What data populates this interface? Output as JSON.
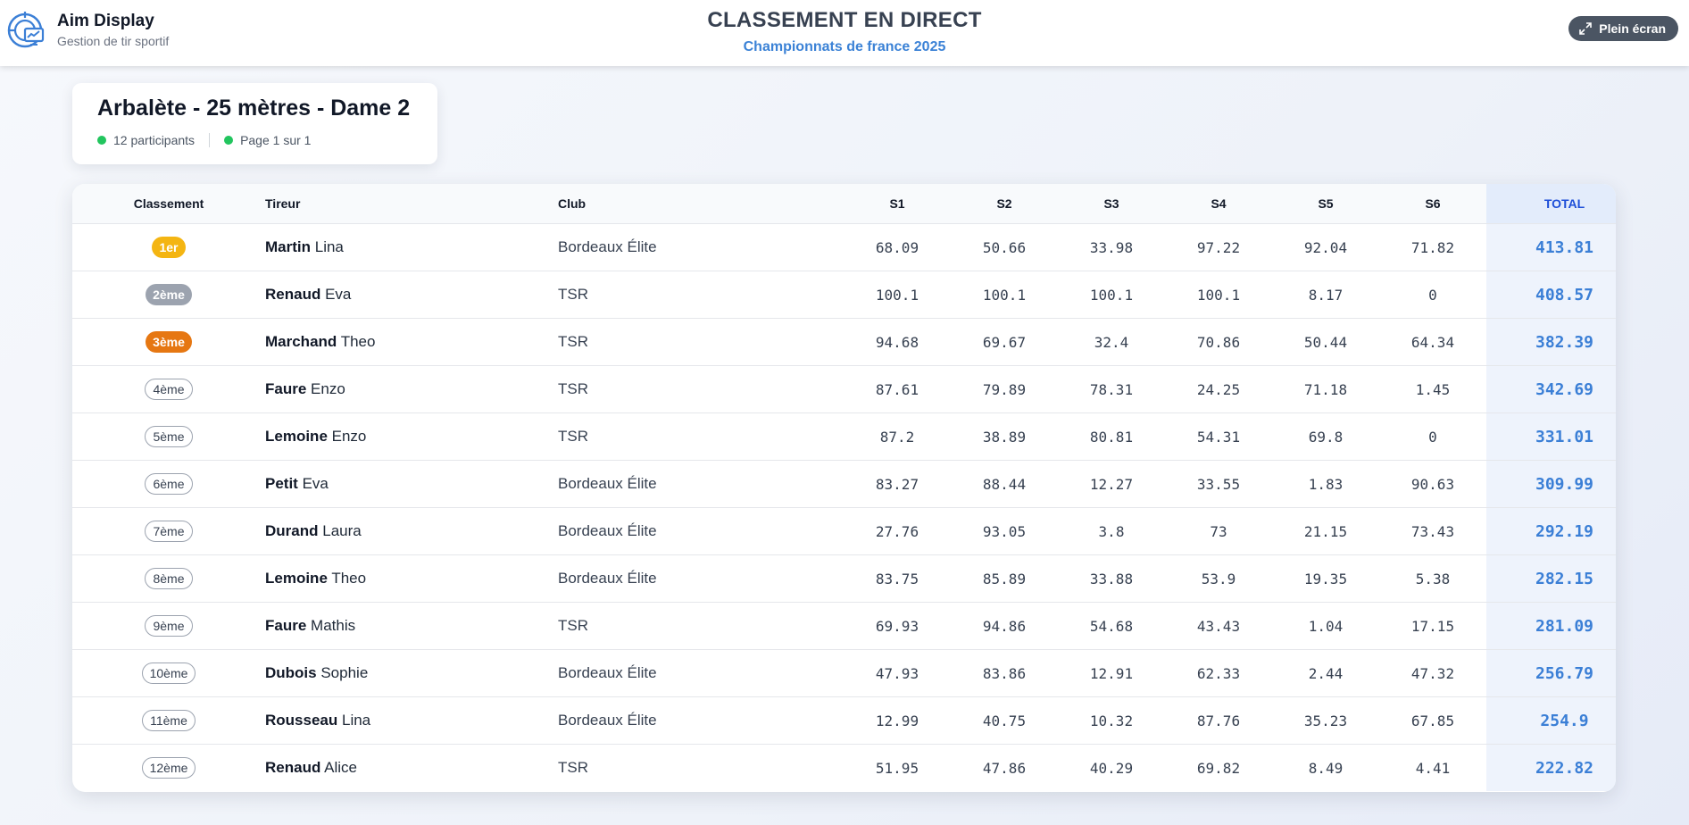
{
  "brand": {
    "name": "Aim Display",
    "tagline": "Gestion de tir sportif",
    "logo_icon": "target-monitor-icon",
    "color": "#3b7fd6"
  },
  "header": {
    "title": "CLASSEMENT EN DIRECT",
    "subtitle": "Championnats de france 2025",
    "fullscreen_label": "Plein écran",
    "fullscreen_icon": "expand-arrows-icon"
  },
  "event": {
    "title": "Arbalète - 25 mètres - Dame 2",
    "participants": "12 participants",
    "page": "Page 1 sur 1",
    "status_color": "#22c55e"
  },
  "table": {
    "headers": {
      "rank": "Classement",
      "shooter": "Tireur",
      "club": "Club",
      "s1": "S1",
      "s2": "S2",
      "s3": "S3",
      "s4": "S4",
      "s5": "S5",
      "s6": "S6",
      "total": "TOTAL"
    },
    "rows": [
      {
        "rank": "1er",
        "last": "Martin",
        "first": "Lina",
        "club": "Bordeaux Élite",
        "s1": "68.09",
        "s2": "50.66",
        "s3": "33.98",
        "s4": "97.22",
        "s5": "92.04",
        "s6": "71.82",
        "total": "413.81"
      },
      {
        "rank": "2ème",
        "last": "Renaud",
        "first": "Eva",
        "club": "TSR",
        "s1": "100.1",
        "s2": "100.1",
        "s3": "100.1",
        "s4": "100.1",
        "s5": "8.17",
        "s6": "0",
        "total": "408.57"
      },
      {
        "rank": "3ème",
        "last": "Marchand",
        "first": "Theo",
        "club": "TSR",
        "s1": "94.68",
        "s2": "69.67",
        "s3": "32.4",
        "s4": "70.86",
        "s5": "50.44",
        "s6": "64.34",
        "total": "382.39"
      },
      {
        "rank": "4ème",
        "last": "Faure",
        "first": "Enzo",
        "club": "TSR",
        "s1": "87.61",
        "s2": "79.89",
        "s3": "78.31",
        "s4": "24.25",
        "s5": "71.18",
        "s6": "1.45",
        "total": "342.69"
      },
      {
        "rank": "5ème",
        "last": "Lemoine",
        "first": "Enzo",
        "club": "TSR",
        "s1": "87.2",
        "s2": "38.89",
        "s3": "80.81",
        "s4": "54.31",
        "s5": "69.8",
        "s6": "0",
        "total": "331.01"
      },
      {
        "rank": "6ème",
        "last": "Petit",
        "first": "Eva",
        "club": "Bordeaux Élite",
        "s1": "83.27",
        "s2": "88.44",
        "s3": "12.27",
        "s4": "33.55",
        "s5": "1.83",
        "s6": "90.63",
        "total": "309.99"
      },
      {
        "rank": "7ème",
        "last": "Durand",
        "first": "Laura",
        "club": "Bordeaux Élite",
        "s1": "27.76",
        "s2": "93.05",
        "s3": "3.8",
        "s4": "73",
        "s5": "21.15",
        "s6": "73.43",
        "total": "292.19"
      },
      {
        "rank": "8ème",
        "last": "Lemoine",
        "first": "Theo",
        "club": "Bordeaux Élite",
        "s1": "83.75",
        "s2": "85.89",
        "s3": "33.88",
        "s4": "53.9",
        "s5": "19.35",
        "s6": "5.38",
        "total": "282.15"
      },
      {
        "rank": "9ème",
        "last": "Faure",
        "first": "Mathis",
        "club": "TSR",
        "s1": "69.93",
        "s2": "94.86",
        "s3": "54.68",
        "s4": "43.43",
        "s5": "1.04",
        "s6": "17.15",
        "total": "281.09"
      },
      {
        "rank": "10ème",
        "last": "Dubois",
        "first": "Sophie",
        "club": "Bordeaux Élite",
        "s1": "47.93",
        "s2": "83.86",
        "s3": "12.91",
        "s4": "62.33",
        "s5": "2.44",
        "s6": "47.32",
        "total": "256.79"
      },
      {
        "rank": "11ème",
        "last": "Rousseau",
        "first": "Lina",
        "club": "Bordeaux Élite",
        "s1": "12.99",
        "s2": "40.75",
        "s3": "10.32",
        "s4": "87.76",
        "s5": "35.23",
        "s6": "67.85",
        "total": "254.9"
      },
      {
        "rank": "12ème",
        "last": "Renaud",
        "first": "Alice",
        "club": "TSR",
        "s1": "51.95",
        "s2": "47.86",
        "s3": "40.29",
        "s4": "69.82",
        "s5": "8.49",
        "s6": "4.41",
        "total": "222.82"
      }
    ],
    "medal_colors": {
      "gold": "#f4b512",
      "silver": "#9ca3af",
      "bronze": "#e67712"
    },
    "total_color": "#3b7fd6"
  }
}
